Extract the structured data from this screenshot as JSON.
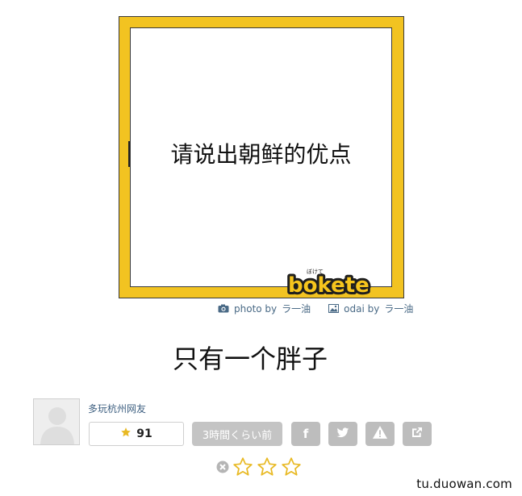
{
  "prompt": {
    "text": "请说出朝鲜的优点"
  },
  "logo": {
    "text": "bokete",
    "badge": "ぼけて"
  },
  "credits": {
    "photo_label": "photo by",
    "photo_author": "ラ一油",
    "odai_label": "odai by",
    "odai_author": "ラ一油"
  },
  "answer": {
    "text": "只有一个胖子"
  },
  "author": {
    "username": "多玩杭州网友"
  },
  "stats": {
    "stars": "91",
    "time_ago": "3時間くらい前"
  },
  "share_buttons": [
    {
      "icon": "facebook-icon",
      "glyph": "f"
    },
    {
      "icon": "twitter-icon"
    },
    {
      "icon": "report-icon"
    },
    {
      "icon": "external-link-icon"
    }
  ],
  "rating": {
    "stars_total": 3,
    "stars_filled": 0
  },
  "watermark": {
    "text": "tu.duowan.com"
  },
  "colors": {
    "frame": "#f2c321",
    "button_gray": "#bdbdbd",
    "star_gold": "#e8b923",
    "link_blue": "#4a6a86"
  }
}
